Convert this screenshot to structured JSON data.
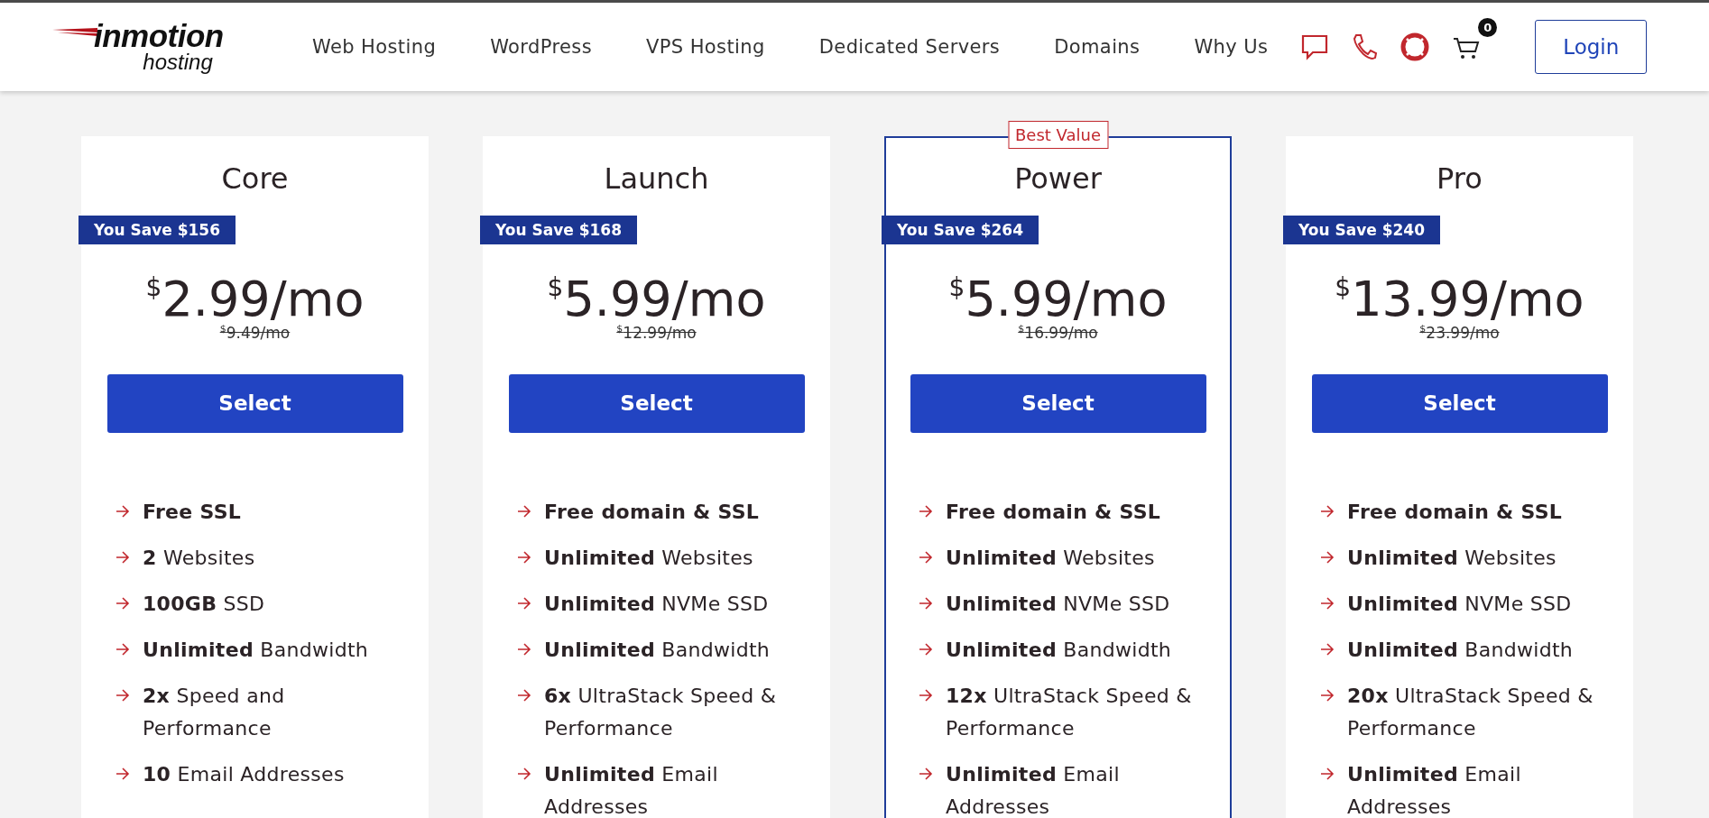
{
  "header": {
    "logo": {
      "word": "inmotion",
      "sub": "hosting"
    },
    "nav": [
      "Web Hosting",
      "WordPress",
      "VPS Hosting",
      "Dedicated Servers",
      "Domains",
      "Why Us"
    ],
    "icons": [
      {
        "kind": "chat"
      },
      {
        "kind": "phone"
      },
      {
        "kind": "support"
      },
      {
        "kind": "cart",
        "badge": "0"
      }
    ],
    "login": "Login"
  },
  "plans": [
    {
      "name": "Core",
      "featured": false,
      "savings": "You Save $156",
      "currency": "$",
      "price": "2.99",
      "period": "/mo",
      "old_currency": "$",
      "old_price": "9.49/mo",
      "button": "Select",
      "features": [
        {
          "strong": "Free SSL"
        },
        {
          "strong": "2",
          "rest": "Websites"
        },
        {
          "strong": "100GB",
          "rest": "SSD"
        },
        {
          "strong": "Unlimited",
          "rest": "Bandwidth"
        },
        {
          "strong": "2x",
          "rest": "Speed and Performance"
        },
        {
          "strong": "10",
          "rest": "Email Addresses"
        }
      ]
    },
    {
      "name": "Launch",
      "featured": false,
      "savings": "You Save $168",
      "currency": "$",
      "price": "5.99",
      "period": "/mo",
      "old_currency": "$",
      "old_price": "12.99/mo",
      "button": "Select",
      "features": [
        {
          "strong": "Free domain & SSL"
        },
        {
          "strong": "Unlimited",
          "rest": "Websites"
        },
        {
          "strong": "Unlimited",
          "rest": "NVMe SSD"
        },
        {
          "strong": "Unlimited",
          "rest": "Bandwidth"
        },
        {
          "strong": "6x",
          "rest": "UltraStack Speed & Performance"
        },
        {
          "strong": "Unlimited",
          "rest": "Email Addresses"
        }
      ]
    },
    {
      "name": "Power",
      "featured": true,
      "ribbon": "Best Value",
      "savings": "You Save $264",
      "currency": "$",
      "price": "5.99",
      "period": "/mo",
      "old_currency": "$",
      "old_price": "16.99/mo",
      "button": "Select",
      "features": [
        {
          "strong": "Free domain & SSL"
        },
        {
          "strong": "Unlimited",
          "rest": "Websites"
        },
        {
          "strong": "Unlimited",
          "rest": "NVMe SSD"
        },
        {
          "strong": "Unlimited",
          "rest": "Bandwidth"
        },
        {
          "strong": "12x",
          "rest": "UltraStack Speed & Performance"
        },
        {
          "strong": "Unlimited",
          "rest": "Email Addresses"
        }
      ]
    },
    {
      "name": "Pro",
      "featured": false,
      "savings": "You Save $240",
      "currency": "$",
      "price": "13.99",
      "period": "/mo",
      "old_currency": "$",
      "old_price": "23.99/mo",
      "button": "Select",
      "features": [
        {
          "strong": "Free domain & SSL"
        },
        {
          "strong": "Unlimited",
          "rest": "Websites"
        },
        {
          "strong": "Unlimited",
          "rest": "NVMe SSD"
        },
        {
          "strong": "Unlimited",
          "rest": "Bandwidth"
        },
        {
          "strong": "20x",
          "rest": "UltraStack Speed & Performance"
        },
        {
          "strong": "Unlimited",
          "rest": "Email Addresses"
        }
      ]
    }
  ]
}
